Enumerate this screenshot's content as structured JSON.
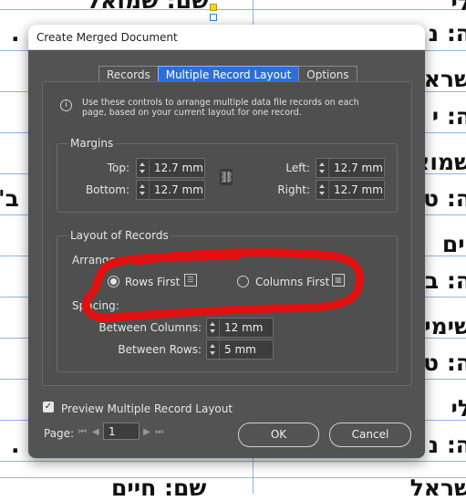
{
  "background": {
    "texts": {
      "t1": "שם: שמואל",
      "t2": "ה: נ",
      "t3": "שראל",
      "t4": "ה: י",
      "t5": "שמוא",
      "t6": "ה: ט",
      "t7": "ב'",
      "t8": "יים",
      "t9": "ה: ב",
      "t10": "שימי",
      "t11": "ה: ט",
      "t12": "לי",
      "t13": "ה: נ",
      "t14": "שם: חיים",
      "t15": "שראל",
      "t16": "לי",
      "dot1": ".",
      "dot2": "."
    }
  },
  "dialog": {
    "title": "Create Merged Document",
    "tabs": [
      "Records",
      "Multiple Record Layout",
      "Options"
    ],
    "info": "Use these controls to arrange multiple data file records on each page, based on your current layout for one record.",
    "margins": {
      "title": "Margins",
      "top_label": "Top:",
      "top": "12.7 mm",
      "bottom_label": "Bottom:",
      "bottom": "12.7 mm",
      "left_label": "Left:",
      "left": "12.7 mm",
      "right_label": "Right:",
      "right": "12.7 mm"
    },
    "layout": {
      "title": "Layout of Records",
      "arrange_label": "Arrange:",
      "rows_first": "Rows First",
      "columns_first": "Columns First",
      "spacing_label": "Spacing:",
      "between_columns_label": "Between Columns:",
      "between_columns": "12 mm",
      "between_rows_label": "Between Rows:",
      "between_rows": "5 mm"
    },
    "preview_label": "Preview Multiple Record Layout",
    "page_label": "Page:",
    "page_value": "1",
    "ok": "OK",
    "cancel": "Cancel"
  },
  "colors": {
    "dialog_bg": "#535353",
    "active_tab": "#2c6fdb",
    "marker": "#e01010",
    "guides": "#8fb3e8"
  }
}
